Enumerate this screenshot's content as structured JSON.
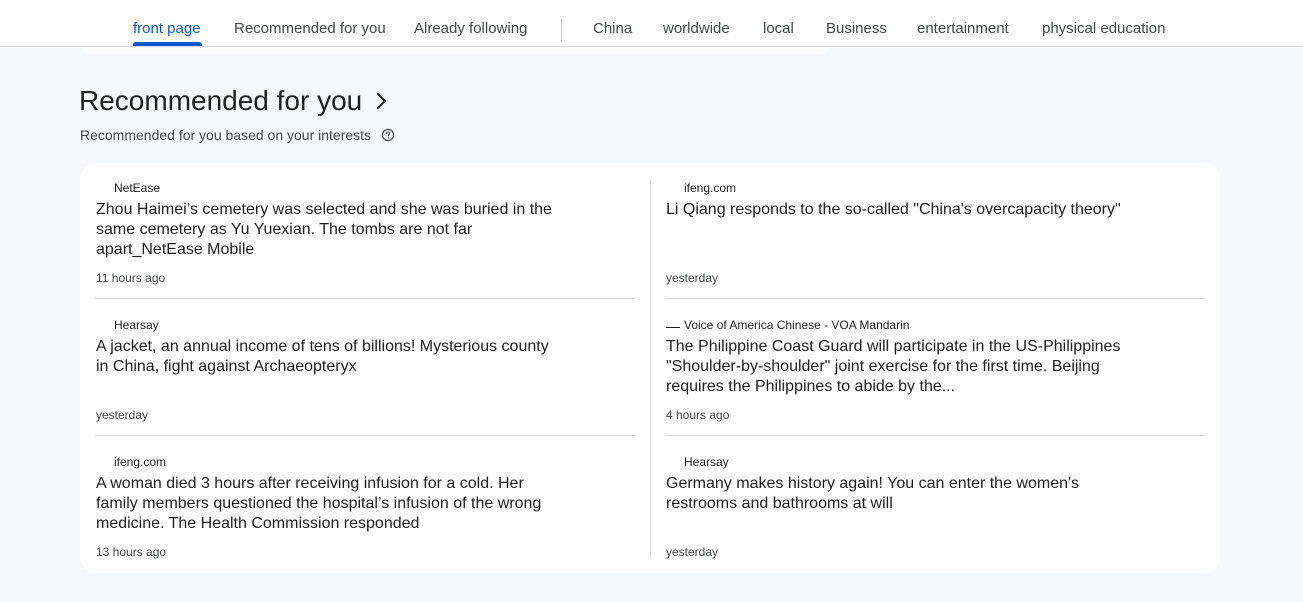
{
  "nav": {
    "tabs": [
      {
        "label": "front page",
        "active": true
      },
      {
        "label": "Recommended for you",
        "active": false
      },
      {
        "label": "Already following",
        "active": false
      },
      {
        "label": "China",
        "active": false
      },
      {
        "label": "worldwide",
        "active": false
      },
      {
        "label": "local",
        "active": false
      },
      {
        "label": "Business",
        "active": false
      },
      {
        "label": "entertainment",
        "active": false
      },
      {
        "label": "physical education",
        "active": false
      }
    ],
    "accent_color": "#0b57d0"
  },
  "section": {
    "title": "Recommended for you",
    "subtitle": "Recommended for you based on your interests",
    "chevron_icon": "chevron-right-icon",
    "help_icon": "help-circle-icon"
  },
  "articles": [
    {
      "source": "NetEase",
      "headline": "Zhou Haimei’s cemetery was selected and she was buried in the same cemetery as Yu Yuexian. The tombs are not far apart_NetEase Mobile",
      "time": "11 hours ago"
    },
    {
      "source": "ifeng.com",
      "headline": "Li Qiang responds to the so-called \"China's overcapacity theory\"",
      "time": "yesterday"
    },
    {
      "source": "Hearsay",
      "headline": "A jacket, an annual income of tens of billions! Mysterious county in China, fight against Archaeopteryx",
      "time": "yesterday"
    },
    {
      "source": "Voice of America Chinese - VOA Mandarin",
      "headline": "The Philippine Coast Guard will participate in the US-Philippines \"Shoulder-by-shoulder\" joint exercise for the first time. Beijing requires the Philippines to abide by the...",
      "time": "4 hours ago"
    },
    {
      "source": "ifeng.com",
      "headline": "A woman died 3 hours after receiving infusion for a cold. Her family members questioned the hospital’s infusion of the wrong medicine. The Health Commission responded",
      "time": "13 hours ago"
    },
    {
      "source": "Hearsay",
      "headline": "Germany makes history again! You can enter the women's restrooms and bathrooms at will",
      "time": "yesterday"
    }
  ]
}
